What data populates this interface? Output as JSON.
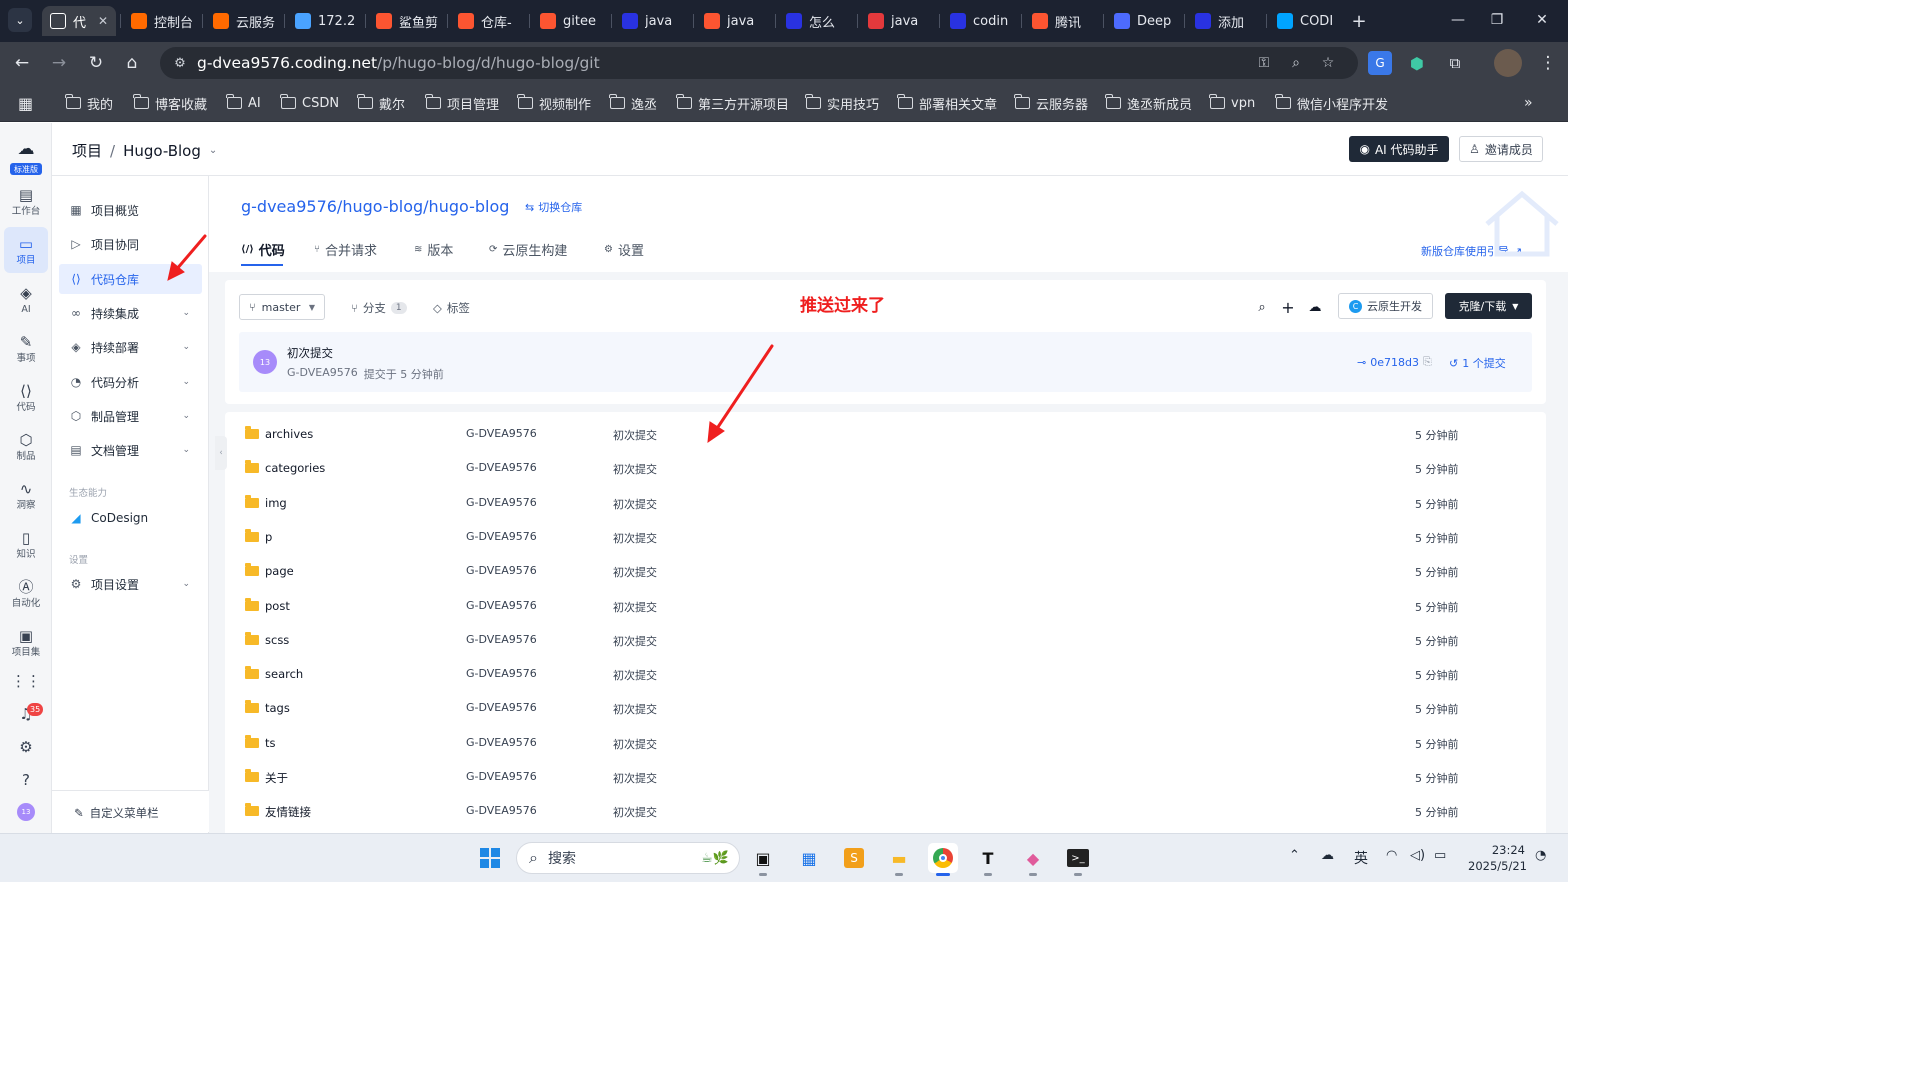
{
  "browser": {
    "tabs": [
      {
        "label": "代",
        "icon": "coding-icon",
        "color": "#ffffff",
        "active": true
      },
      {
        "label": "控制台",
        "icon": "aliyun-icon",
        "color": "#ff6a00"
      },
      {
        "label": "云服务",
        "icon": "aliyun-icon",
        "color": "#ff6a00"
      },
      {
        "label": "172.2",
        "icon": "server-icon",
        "color": "#4aa3ff"
      },
      {
        "label": "鲨鱼剪",
        "icon": "csdn-icon",
        "color": "#fc5531"
      },
      {
        "label": "仓库-",
        "icon": "csdn-icon",
        "color": "#fc5531"
      },
      {
        "label": "gitee",
        "icon": "csdn-icon",
        "color": "#fc5531"
      },
      {
        "label": "java",
        "icon": "baidu-icon",
        "color": "#2932e1"
      },
      {
        "label": "java",
        "icon": "csdn-icon",
        "color": "#fc5531"
      },
      {
        "label": "怎么",
        "icon": "baidu-icon",
        "color": "#2932e1"
      },
      {
        "label": "java",
        "icon": "51cto-icon",
        "color": "#e4393c"
      },
      {
        "label": "codin",
        "icon": "baidu-icon",
        "color": "#2932e1"
      },
      {
        "label": "腾讯",
        "icon": "csdn-icon",
        "color": "#fc5531"
      },
      {
        "label": "Deep",
        "icon": "deepseek-icon",
        "color": "#4d6bfe"
      },
      {
        "label": "添加",
        "icon": "baidu-icon",
        "color": "#2932e1"
      },
      {
        "label": "CODI",
        "icon": "coding-cloud-icon",
        "color": "#00a4ff"
      }
    ],
    "url_host": "g-dvea9576.coding.net",
    "url_path": "/p/hugo-blog/d/hugo-blog/git",
    "bookmarks": [
      "我的",
      "博客收藏",
      "AI",
      "CSDN",
      "戴尔",
      "项目管理",
      "视频制作",
      "逸丞",
      "第三方开源项目",
      "实用技巧",
      "部署相关文章",
      "云服务器",
      "逸丞新成员",
      "vpn",
      "微信小程序开发"
    ]
  },
  "rail": {
    "logo_badge": "标准版",
    "items": [
      {
        "label": "工作台",
        "icon": "dashboard-icon"
      },
      {
        "label": "项目",
        "icon": "project-icon",
        "active": true
      },
      {
        "label": "AI",
        "icon": "ai-icon"
      },
      {
        "label": "事项",
        "icon": "issue-icon"
      },
      {
        "label": "代码",
        "icon": "code-icon"
      },
      {
        "label": "制品",
        "icon": "artifact-icon"
      },
      {
        "label": "洞察",
        "icon": "insight-icon"
      },
      {
        "label": "知识",
        "icon": "knowledge-icon"
      },
      {
        "label": "自动化",
        "icon": "automation-icon"
      },
      {
        "label": "项目集",
        "icon": "program-icon"
      }
    ],
    "notif_count": "35",
    "user_initials": "13"
  },
  "header": {
    "crumb_root": "项目",
    "crumb_sep": "/",
    "crumb_project": "Hugo-Blog",
    "ai_button": "AI 代码助手",
    "invite_button": "邀请成员"
  },
  "sidebar": {
    "items": [
      {
        "label": "项目概览",
        "icon": "grid-icon"
      },
      {
        "label": "项目协同",
        "icon": "play-icon"
      },
      {
        "label": "代码仓库",
        "icon": "code-repo-icon",
        "active": true
      },
      {
        "label": "持续集成",
        "icon": "ci-icon",
        "expand": true
      },
      {
        "label": "持续部署",
        "icon": "deploy-icon",
        "expand": true
      },
      {
        "label": "代码分析",
        "icon": "analysis-icon",
        "expand": true
      },
      {
        "label": "制品管理",
        "icon": "box-icon",
        "expand": true
      },
      {
        "label": "文档管理",
        "icon": "doc-icon",
        "expand": true
      }
    ],
    "eco_section": "生态能力",
    "eco_item": "CoDesign",
    "settings_section": "设置",
    "settings_item": "项目设置",
    "customize": "自定义菜单栏"
  },
  "repo": {
    "title": "g-dvea9576/hugo-blog/hugo-blog",
    "switch_label": "切换仓库",
    "tabs": [
      {
        "label": "代码",
        "icon": "code-icon",
        "active": true
      },
      {
        "label": "合并请求",
        "icon": "merge-icon"
      },
      {
        "label": "版本",
        "icon": "layers-icon"
      },
      {
        "label": "云原生构建",
        "icon": "build-icon"
      },
      {
        "label": "设置",
        "icon": "gear-icon"
      }
    ],
    "guide_link": "新版仓库使用引导",
    "branch": "master",
    "branches_label": "分支",
    "branches_count": "1",
    "tags_label": "标签",
    "cloud_button": "云原生开发",
    "clone_button": "克隆/下载"
  },
  "commit": {
    "avatar": "13",
    "message": "初次提交",
    "author": "G-DVEA9576",
    "time": "提交于 5 分钟前",
    "hash": "0e718d3",
    "count": "1 个提交"
  },
  "files": [
    {
      "name": "archives",
      "author": "G-DVEA9576",
      "commit": "初次提交",
      "time": "5 分钟前"
    },
    {
      "name": "categories",
      "author": "G-DVEA9576",
      "commit": "初次提交",
      "time": "5 分钟前"
    },
    {
      "name": "img",
      "author": "G-DVEA9576",
      "commit": "初次提交",
      "time": "5 分钟前"
    },
    {
      "name": "p",
      "author": "G-DVEA9576",
      "commit": "初次提交",
      "time": "5 分钟前"
    },
    {
      "name": "page",
      "author": "G-DVEA9576",
      "commit": "初次提交",
      "time": "5 分钟前"
    },
    {
      "name": "post",
      "author": "G-DVEA9576",
      "commit": "初次提交",
      "time": "5 分钟前"
    },
    {
      "name": "scss",
      "author": "G-DVEA9576",
      "commit": "初次提交",
      "time": "5 分钟前"
    },
    {
      "name": "search",
      "author": "G-DVEA9576",
      "commit": "初次提交",
      "time": "5 分钟前"
    },
    {
      "name": "tags",
      "author": "G-DVEA9576",
      "commit": "初次提交",
      "time": "5 分钟前"
    },
    {
      "name": "ts",
      "author": "G-DVEA9576",
      "commit": "初次提交",
      "time": "5 分钟前"
    },
    {
      "name": "关于",
      "author": "G-DVEA9576",
      "commit": "初次提交",
      "time": "5 分钟前"
    },
    {
      "name": "友情链接",
      "author": "G-DVEA9576",
      "commit": "初次提交",
      "time": "5 分钟前"
    }
  ],
  "annotation": "推送过来了",
  "taskbar": {
    "search_placeholder": "搜索",
    "ime": "英",
    "time": "23:24",
    "date": "2025/5/21"
  },
  "colors": {
    "accent": "#2563eb",
    "annotation": "#ef1f1f",
    "folder": "#f7b928"
  }
}
